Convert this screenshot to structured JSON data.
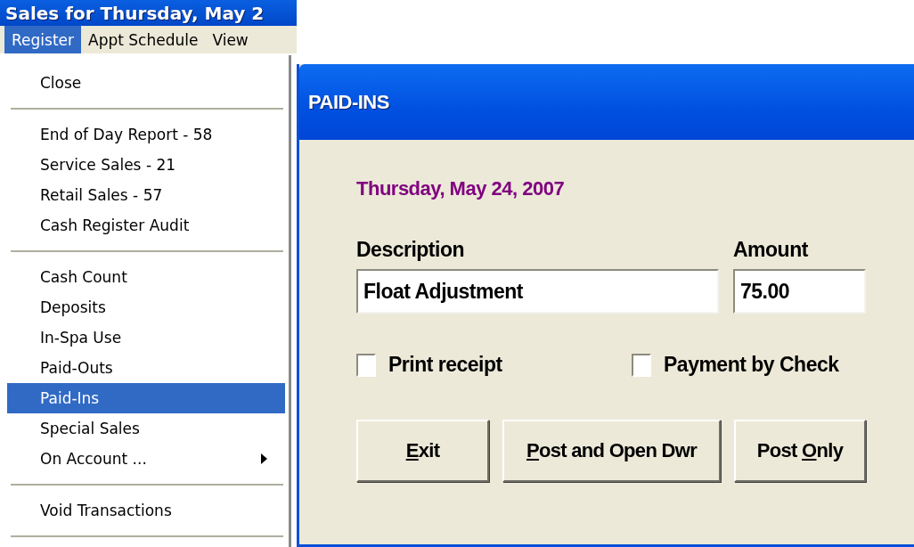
{
  "main_window": {
    "title": "Sales for Thursday, May 2",
    "menu_bar": [
      {
        "label": "Register",
        "selected": true
      },
      {
        "label": "Appt Schedule",
        "selected": false
      },
      {
        "label": "View",
        "selected": false
      }
    ],
    "menu": [
      {
        "kind": "item",
        "label": "Close",
        "selected": false,
        "submenu": false
      },
      {
        "kind": "separator"
      },
      {
        "kind": "item",
        "label": "End of Day Report - 58",
        "selected": false,
        "submenu": false
      },
      {
        "kind": "item",
        "label": "Service Sales - 21",
        "selected": false,
        "submenu": false
      },
      {
        "kind": "item",
        "label": "Retail Sales - 57",
        "selected": false,
        "submenu": false
      },
      {
        "kind": "item",
        "label": "Cash Register Audit",
        "selected": false,
        "submenu": false
      },
      {
        "kind": "separator"
      },
      {
        "kind": "item",
        "label": "Cash Count",
        "selected": false,
        "submenu": false
      },
      {
        "kind": "item",
        "label": "Deposits",
        "selected": false,
        "submenu": false
      },
      {
        "kind": "item",
        "label": "In-Spa Use",
        "selected": false,
        "submenu": false
      },
      {
        "kind": "item",
        "label": "Paid-Outs",
        "selected": false,
        "submenu": false
      },
      {
        "kind": "item",
        "label": "Paid-Ins",
        "selected": true,
        "submenu": false
      },
      {
        "kind": "item",
        "label": "Special Sales",
        "selected": false,
        "submenu": false
      },
      {
        "kind": "item",
        "label": "On Account ...",
        "selected": false,
        "submenu": true
      },
      {
        "kind": "separator"
      },
      {
        "kind": "item",
        "label": "Void Transactions",
        "selected": false,
        "submenu": false
      },
      {
        "kind": "separator"
      }
    ]
  },
  "dialog": {
    "title": "PAID-INS",
    "date": "Thursday, May 24, 2007",
    "description": {
      "label": "Description",
      "value": "Float Adjustment"
    },
    "amount": {
      "label": "Amount",
      "value": "75.00"
    },
    "checkboxes": [
      {
        "label": "Print receipt",
        "checked": false
      },
      {
        "label": "Payment by Check",
        "checked": false
      }
    ],
    "buttons": [
      {
        "access_key": "E",
        "label_after": "xit"
      },
      {
        "access_key": "P",
        "label_after": "ost and Open Dwr"
      },
      {
        "label_before": "Post ",
        "access_key": "O",
        "label_after": "nly"
      }
    ]
  }
}
